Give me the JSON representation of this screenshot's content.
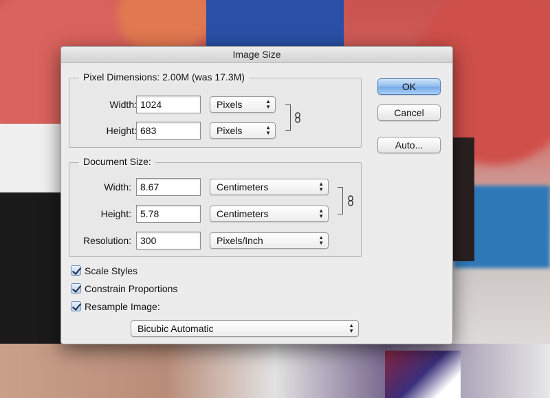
{
  "dialog": {
    "title": "Image Size",
    "buttons": {
      "ok": "OK",
      "cancel": "Cancel",
      "auto": "Auto..."
    }
  },
  "pixel_dimensions": {
    "legend": "Pixel Dimensions:  2.00M (was 17.3M)",
    "width_label": "Width:",
    "width_value": "1024",
    "width_unit": "Pixels",
    "height_label": "Height:",
    "height_value": "683",
    "height_unit": "Pixels"
  },
  "document_size": {
    "legend": "Document Size:",
    "width_label": "Width:",
    "width_value": "8.67",
    "width_unit": "Centimeters",
    "height_label": "Height:",
    "height_value": "5.78",
    "height_unit": "Centimeters",
    "resolution_label": "Resolution:",
    "resolution_value": "300",
    "resolution_unit": "Pixels/Inch"
  },
  "options": {
    "scale_styles": {
      "label": "Scale Styles",
      "checked": true
    },
    "constrain_proportions": {
      "label": "Constrain Proportions",
      "checked": true
    },
    "resample_image": {
      "label": "Resample Image:",
      "checked": true
    },
    "resample_method": "Bicubic Automatic"
  },
  "icons": {
    "link": "chain-link-icon",
    "select_arrows": "up-down-arrows-icon"
  },
  "colors": {
    "ok_button": "#8fbbec",
    "dialog_bg": "#ececec"
  }
}
